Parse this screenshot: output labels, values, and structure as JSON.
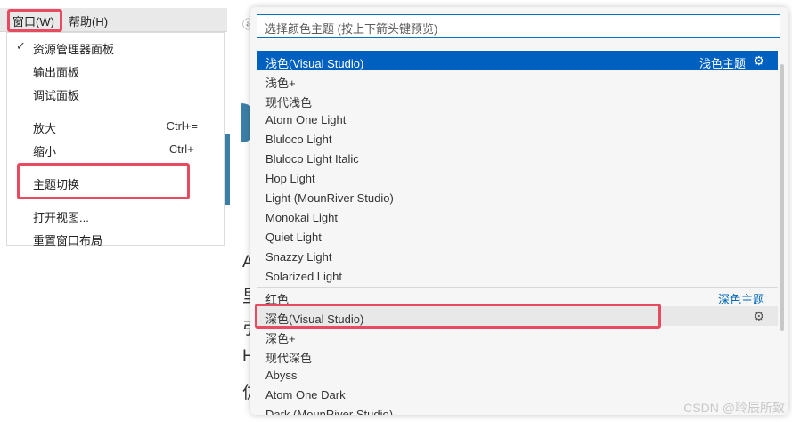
{
  "menubar": {
    "window": "窗口(W)",
    "help": "帮助(H)"
  },
  "window_menu": {
    "explorer": "资源管理器面板",
    "output": "输出面板",
    "debug": "调试面板",
    "zoom_in": "放大",
    "zoom_in_shortcut": "Ctrl+=",
    "zoom_out": "缩小",
    "zoom_out_shortcut": "Ctrl+-",
    "theme_switch": "主题切换",
    "open_view": "打开视图...",
    "reset_layout": "重置窗口布局",
    "checkmark": "✓"
  },
  "background_chars": [
    "A",
    "里",
    "引",
    "H",
    "仿"
  ],
  "theme_picker": {
    "placeholder": "选择颜色主题 (按上下箭头键预览)",
    "light_group": "浅色主题",
    "dark_group": "深色主题",
    "light_themes": [
      "浅色(Visual Studio)",
      "浅色+",
      "现代浅色",
      "Atom One Light",
      "Bluloco Light",
      "Bluloco Light Italic",
      "Hop Light",
      "Light (MounRiver Studio)",
      "Monokai Light",
      "Quiet Light",
      "Snazzy Light",
      "Solarized Light"
    ],
    "dark_themes": [
      "红色",
      "深色(Visual Studio)",
      "深色+",
      "现代深色",
      "Abyss",
      "Atom One Dark",
      "Dark (MounRiver Studio)"
    ]
  },
  "watermark": "CSDN @聆辰所致"
}
